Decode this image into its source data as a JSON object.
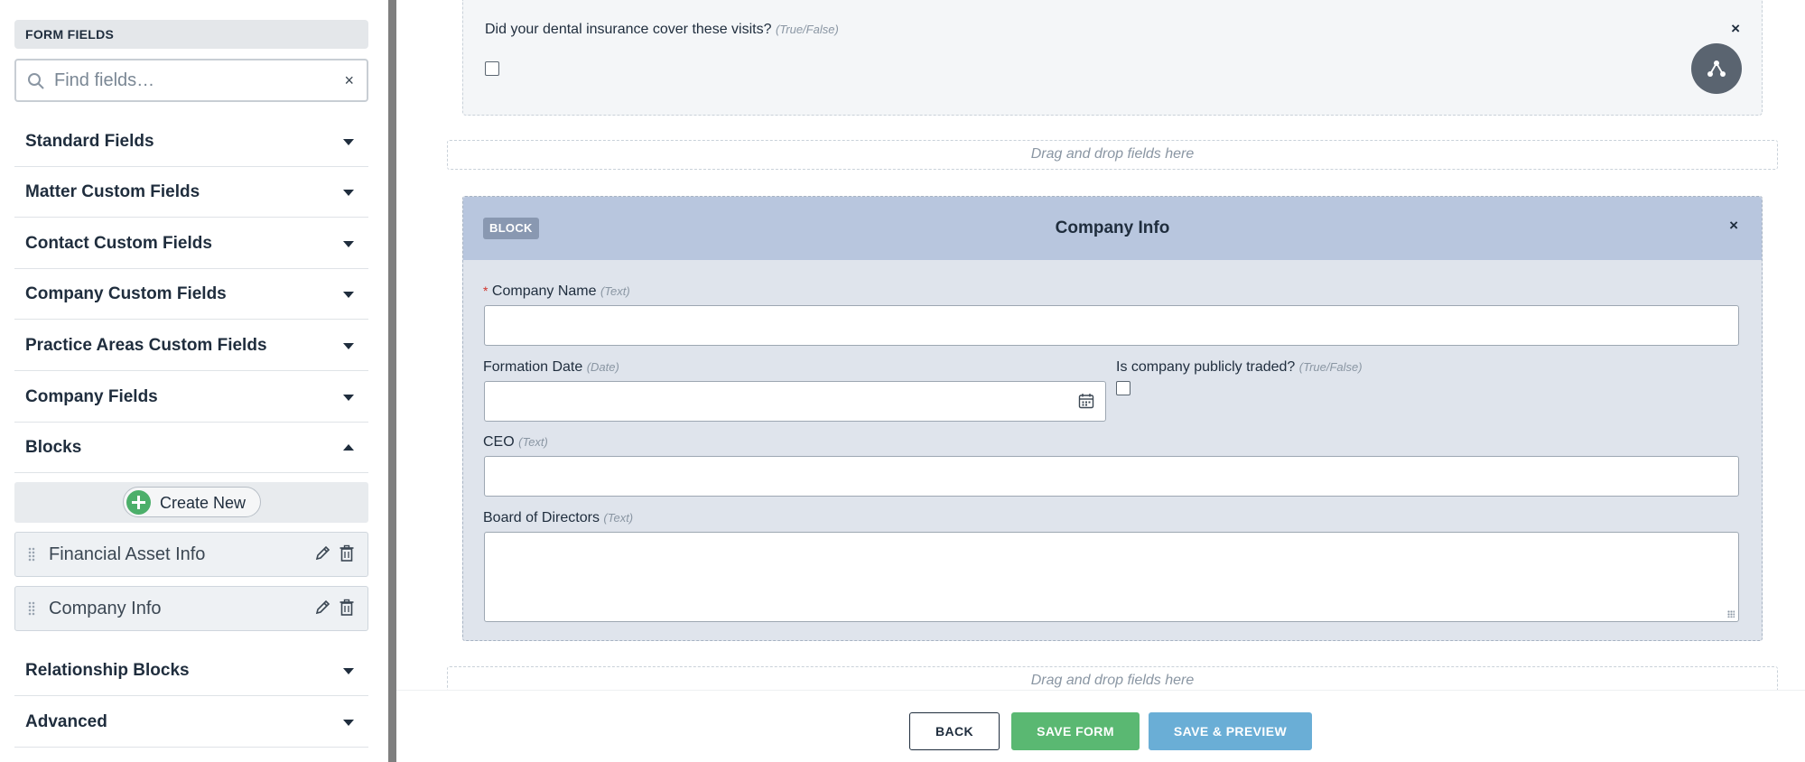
{
  "sidebar": {
    "header": "FORM FIELDS",
    "search": {
      "placeholder": "Find fields…",
      "value": ""
    },
    "sections": [
      {
        "label": "Standard Fields",
        "expanded": false
      },
      {
        "label": "Matter Custom Fields",
        "expanded": false
      },
      {
        "label": "Contact Custom Fields",
        "expanded": false
      },
      {
        "label": "Company Custom Fields",
        "expanded": false
      },
      {
        "label": "Practice Areas Custom Fields",
        "expanded": false
      },
      {
        "label": "Company Fields",
        "expanded": false
      },
      {
        "label": "Blocks",
        "expanded": true
      },
      {
        "label": "Relationship Blocks",
        "expanded": false
      },
      {
        "label": "Advanced",
        "expanded": false
      }
    ],
    "create_new_label": "Create New",
    "blocks": [
      {
        "name": "Financial Asset Info"
      },
      {
        "name": "Company Info"
      }
    ]
  },
  "main": {
    "question": {
      "label": "Did your dental insurance cover these visits?",
      "type_hint": "(True/False)",
      "close": "×",
      "checked": false
    },
    "dropzone_text": "Drag and drop fields here",
    "block": {
      "tag": "BLOCK",
      "title": "Company Info",
      "close": "×",
      "fields": {
        "company_name": {
          "label": "Company Name",
          "hint": "(Text)",
          "required_mark": "*",
          "value": ""
        },
        "formation_date": {
          "label": "Formation Date",
          "hint": "(Date)",
          "value": ""
        },
        "publicly_traded": {
          "label": "Is company publicly traded?",
          "hint": "(True/False)",
          "checked": false
        },
        "ceo": {
          "label": "CEO",
          "hint": "(Text)",
          "value": ""
        },
        "board": {
          "label": "Board of Directors",
          "hint": "(Text)",
          "value": ""
        }
      }
    },
    "footer": {
      "back": "BACK",
      "save": "SAVE FORM",
      "save_preview": "SAVE & PREVIEW"
    }
  },
  "colors": {
    "save": "#5ab872",
    "preview": "#6aaed6",
    "block_header": "#b8c6de",
    "required": "#d0342c",
    "create_plus": "#4caf6a"
  },
  "icons": [
    "search-icon",
    "clear-icon",
    "caret-down-icon",
    "caret-up-icon",
    "plus-circle-icon",
    "drag-handle-icon",
    "pencil-icon",
    "trash-icon",
    "close-icon",
    "hierarchy-icon",
    "calendar-icon"
  ]
}
